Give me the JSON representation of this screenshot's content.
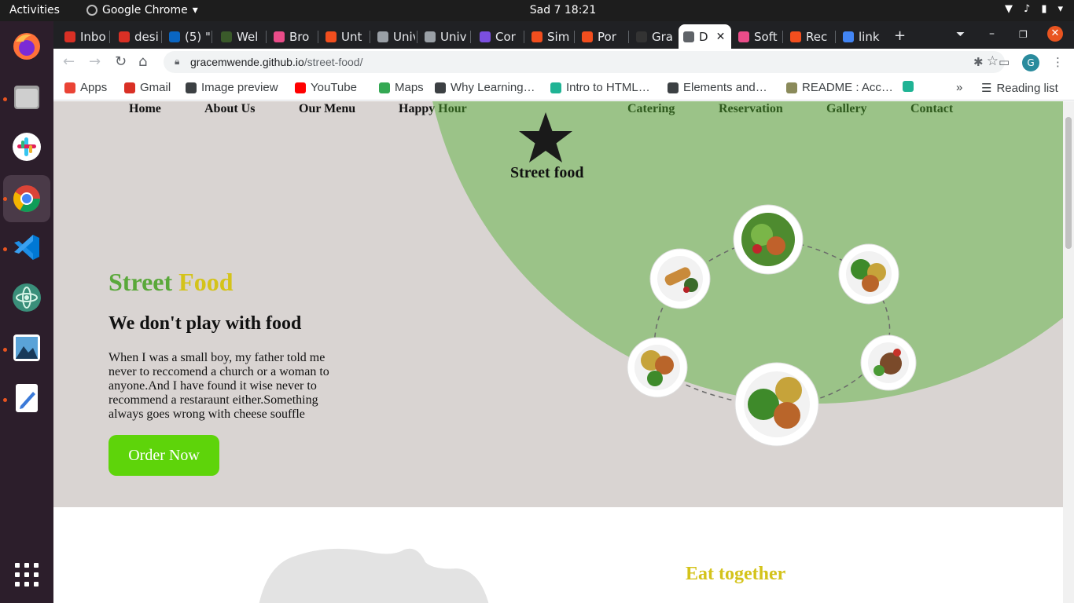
{
  "os": {
    "activities": "Activities",
    "app_name": "Google Chrome",
    "clock": "Sad 7  18:21"
  },
  "tabs": [
    {
      "label": "Inbo",
      "color": "#d93025"
    },
    {
      "label": "desi",
      "color": "#d93025"
    },
    {
      "label": "(5) \"",
      "color": "#0a66c2"
    },
    {
      "label": "Wel",
      "color": "#3a5a2a"
    },
    {
      "label": "Bro",
      "color": "#ea4c89"
    },
    {
      "label": "Unt",
      "color": "#f24e1e"
    },
    {
      "label": "Univ",
      "color": "#9aa0a6"
    },
    {
      "label": "Univ",
      "color": "#9aa0a6"
    },
    {
      "label": "Cor",
      "color": "#7b4fe0"
    },
    {
      "label": "Sim",
      "color": "#f24e1e"
    },
    {
      "label": "Por",
      "color": "#f24e1e"
    },
    {
      "label": "Gra",
      "color": "#333333"
    },
    {
      "label": "D",
      "color": "#5f6368",
      "active": true
    },
    {
      "label": "Soft",
      "color": "#ea4c89"
    },
    {
      "label": "Rec",
      "color": "#f24e1e"
    },
    {
      "label": "link",
      "color": "#4285f4"
    }
  ],
  "toolbar": {
    "url_host": "gracemwende.github.io",
    "url_path": "/street-food/",
    "profile_initial": "G"
  },
  "bookmarks": [
    {
      "label": "Apps",
      "color": "#ea4335"
    },
    {
      "label": "Gmail",
      "color": "#d93025"
    },
    {
      "label": "Image preview",
      "color": "#3c4043"
    },
    {
      "label": "YouTube",
      "color": "#ff0000"
    },
    {
      "label": "Maps",
      "color": "#34a853"
    },
    {
      "label": "Why Learning…",
      "color": "#3c4043"
    },
    {
      "label": "Intro to HTML…",
      "color": "#1fb394"
    },
    {
      "label": "Elements and…",
      "color": "#3c4043"
    },
    {
      "label": "README : Acc…",
      "color": "#8a8a5a"
    }
  ],
  "reading_list": "Reading list",
  "site": {
    "nav": {
      "home": "Home",
      "about": "About Us",
      "menu": "Our Menu",
      "happy_hour": "Happy Hour",
      "catering": "Catering",
      "reservation": "Reservation",
      "gallery": "Gallery",
      "contact": "Contact"
    },
    "logo_text": "Street food",
    "hero": {
      "title_word1": "Street",
      "title_word2": "Food",
      "subtitle": "We don't play with food",
      "description": "When I was a small boy, my father told me never to reccomend a church or a woman to anyone.And I have found it wise never to recommend a restaraunt either.Something always goes wrong with cheese souffle",
      "order_button": "Order Now"
    },
    "section2_title": "Eat together",
    "colors": {
      "hero_bg": "#d9d4d2",
      "green_circle": "#9bc388",
      "title_green": "#5aa83a",
      "title_yellow": "#d4c31a",
      "button_green": "#5ed40a"
    }
  }
}
